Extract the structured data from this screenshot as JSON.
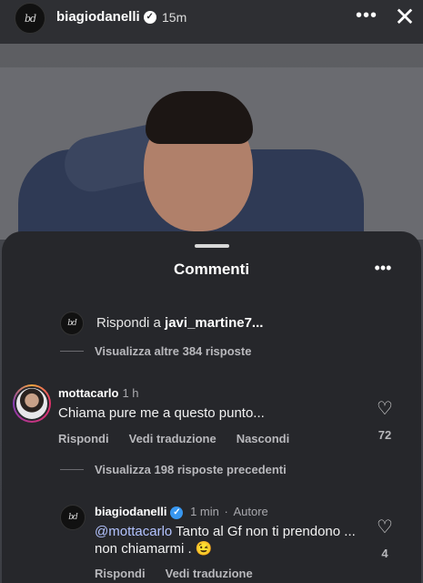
{
  "story": {
    "username": "biagiodanelli",
    "time": "15m",
    "more_icon": "more-horizontal-icon",
    "close_icon": "close-icon"
  },
  "comments_sheet": {
    "title": "Commenti",
    "reply_prompt": {
      "prefix": "Rispondi a ",
      "target": "javi_martine7..."
    },
    "view_more_replies": "Visualizza altre 384 risposte",
    "comments": [
      {
        "username": "mottacarlo",
        "time": "1 h",
        "text": "Chiama pure me a questo punto...",
        "actions": [
          "Rispondi",
          "Vedi traduzione",
          "Nascondi"
        ],
        "likes": "72"
      },
      {
        "username": "biagiodanelli",
        "time": "1 min",
        "role": "Autore",
        "separator": "·",
        "mention": "@mottacarlo",
        "text": " Tanto al Gf non ti prendono ... non chiamarmi . 😉",
        "actions": [
          "Rispondi",
          "Vedi traduzione"
        ],
        "likes": "4"
      }
    ],
    "view_previous_replies": "Visualizza 198 risposte precedenti"
  },
  "colors": {
    "sheet_bg": "#26272b",
    "mention": "#b3c3ff",
    "muted_text": "#b8b8bc"
  }
}
